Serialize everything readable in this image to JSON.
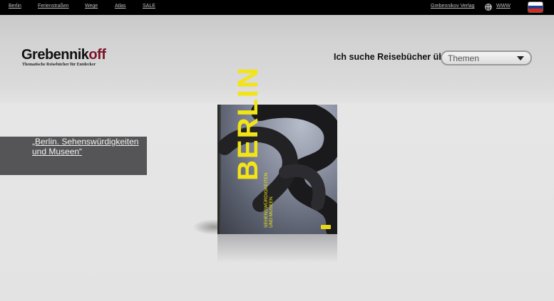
{
  "nav": {
    "items": [
      {
        "label": "Berlin"
      },
      {
        "label": "Ferienstraßen"
      },
      {
        "label": "Wege"
      },
      {
        "label": "Atlas"
      },
      {
        "label": "SALE"
      }
    ],
    "publisher_label": "Grebennikov Verlag",
    "www_label": "WWW",
    "language_flag": "russian-flag"
  },
  "header": {
    "logo_main": "Grebennik",
    "logo_accent": "off",
    "tagline": "Thematische Reisebücher für Entdecker",
    "search_label": "Ich suche Reisebücher über",
    "select_value": "Themen"
  },
  "feature": {
    "title_link": "„Berlin. Sehenswürdigkeiten und Museen“"
  },
  "book": {
    "cover_title": "BERLIN",
    "cover_subtitle_1": "SEHENSWÜRDIGKEITEN",
    "cover_subtitle_2": "UND MUSEEN"
  },
  "colors": {
    "accent": "#7a1427",
    "cover_yellow": "#f2e416",
    "topbar": "#000000"
  }
}
